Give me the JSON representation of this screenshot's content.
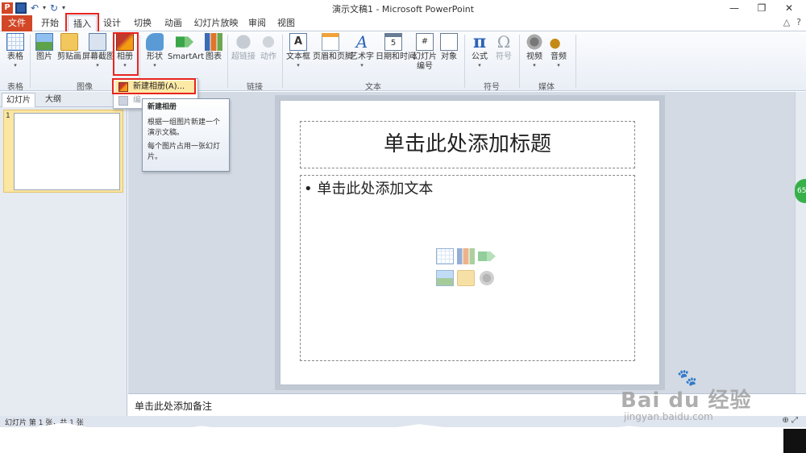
{
  "window": {
    "title": "演示文稿1 - Microsoft PowerPoint",
    "app_icon": "powerpoint-icon",
    "minimize": "—",
    "restore": "❐",
    "close": "✕"
  },
  "qat": {
    "app_letter": "P",
    "undo": "↶",
    "redo": "↻",
    "more": "▾"
  },
  "tabs": [
    {
      "label": "文件"
    },
    {
      "label": "开始"
    },
    {
      "label": "插入"
    },
    {
      "label": "设计"
    },
    {
      "label": "切换"
    },
    {
      "label": "动画"
    },
    {
      "label": "幻灯片放映"
    },
    {
      "label": "审阅"
    },
    {
      "label": "视图"
    }
  ],
  "help": {
    "caret": "△",
    "question": "?"
  },
  "ribbon": {
    "table_group": {
      "label": "表格",
      "btn": "表格"
    },
    "image_group": {
      "label": "图像",
      "picture": "图片",
      "clipart": "剪贴画",
      "screenshot": "屏幕截图",
      "album": "相册"
    },
    "illus_group": {
      "shapes": "形状",
      "smartart": "SmartArt",
      "chart": "图表"
    },
    "links_group": {
      "label": "链接",
      "hyperlink": "超链接",
      "action": "动作"
    },
    "text_group": {
      "label": "文本",
      "textbox": "文本框",
      "header_footer": "页眉和页脚",
      "wordart": "艺术字",
      "datetime": "日期和时间",
      "slide_number_1": "幻灯片",
      "slide_number_2": "编号",
      "object": "对象",
      "textbox_glyph": "A",
      "wordart_glyph": "A",
      "date_glyph": "5",
      "slidenum_glyph": "#"
    },
    "symbols_group": {
      "label": "符号",
      "formula": "公式",
      "symbol": "符号",
      "formula_glyph": "π",
      "symbol_glyph": "Ω"
    },
    "media_group": {
      "label": "媒体",
      "video": "视频",
      "audio": "音频"
    }
  },
  "album_menu": {
    "new_album": "新建相册(A)...",
    "edit_album": "编"
  },
  "tooltip": {
    "title": "新建相册",
    "line1": "根据一组图片新建一个演示文稿。",
    "line2": "每个图片占用一张幻灯片。"
  },
  "left_pane": {
    "tab_slides": "幻灯片",
    "tab_outline": "大纲",
    "close": "✕",
    "slide_number": "1"
  },
  "slide": {
    "title_placeholder": "单击此处添加标题",
    "body_placeholder": "• 单击此处添加文本"
  },
  "notes": {
    "placeholder": "单击此处添加备注"
  },
  "status": {
    "text": "幻灯片 第 1 张，共 1 张",
    "zoom_in": "⊕",
    "fit": "⤢"
  },
  "badge": {
    "text": "65"
  },
  "watermark": {
    "brand": "Bai  du 经验",
    "url": "jingyan.baidu.com",
    "paw": "🐾"
  }
}
